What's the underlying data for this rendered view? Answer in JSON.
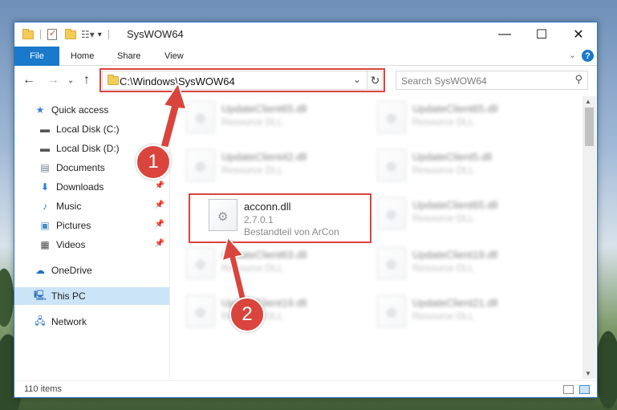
{
  "window": {
    "title": "SysWOW64"
  },
  "ribbon": {
    "tabs": [
      "File",
      "Home",
      "Share",
      "View"
    ],
    "help_label": "?"
  },
  "nav": {
    "address": "C:\\Windows\\SysWOW64",
    "search_placeholder": "Search SysWOW64"
  },
  "sidebar": {
    "items": [
      {
        "label": "Quick access",
        "icon": "star-icon"
      },
      {
        "label": "Local Disk (C:)",
        "icon": "drive-icon"
      },
      {
        "label": "Local Disk (D:)",
        "icon": "drive-icon"
      },
      {
        "label": "Documents",
        "icon": "documents-icon"
      },
      {
        "label": "Downloads",
        "icon": "download-icon"
      },
      {
        "label": "Music",
        "icon": "music-icon"
      },
      {
        "label": "Pictures",
        "icon": "pictures-icon"
      },
      {
        "label": "Videos",
        "icon": "videos-icon"
      },
      {
        "label": "OneDrive",
        "icon": "cloud-icon"
      },
      {
        "label": "This PC",
        "icon": "computer-icon"
      },
      {
        "label": "Network",
        "icon": "network-icon"
      }
    ]
  },
  "files": [
    {
      "name": "UpdateClient65.dll",
      "desc": "Resource DLL"
    },
    {
      "name": "UpdateClient65.dll",
      "desc": "Resource DLL"
    },
    {
      "name": "UpdateClient42.dll",
      "desc": "Resource DLL"
    },
    {
      "name": "UpdateClient5.dll",
      "desc": "Resource DLL"
    },
    {
      "name": "acconn.dll",
      "desc": "2.7.0.1",
      "desc2": "Bestandteil von ArCon"
    },
    {
      "name": "UpdateClient65.dll",
      "desc": "Resource DLL"
    },
    {
      "name": "UpdateClient63.dll",
      "desc": "Resource DLL"
    },
    {
      "name": "UpdateClient19.dll",
      "desc": "Resource DLL"
    },
    {
      "name": "UpdateClient19.dll",
      "desc": "Resource DLL"
    },
    {
      "name": "UpdateClient21.dll",
      "desc": "Resource DLL"
    }
  ],
  "status": {
    "items_count": "110 items"
  },
  "annotations": {
    "step1": "1",
    "step2": "2",
    "color": "#d9453d"
  }
}
